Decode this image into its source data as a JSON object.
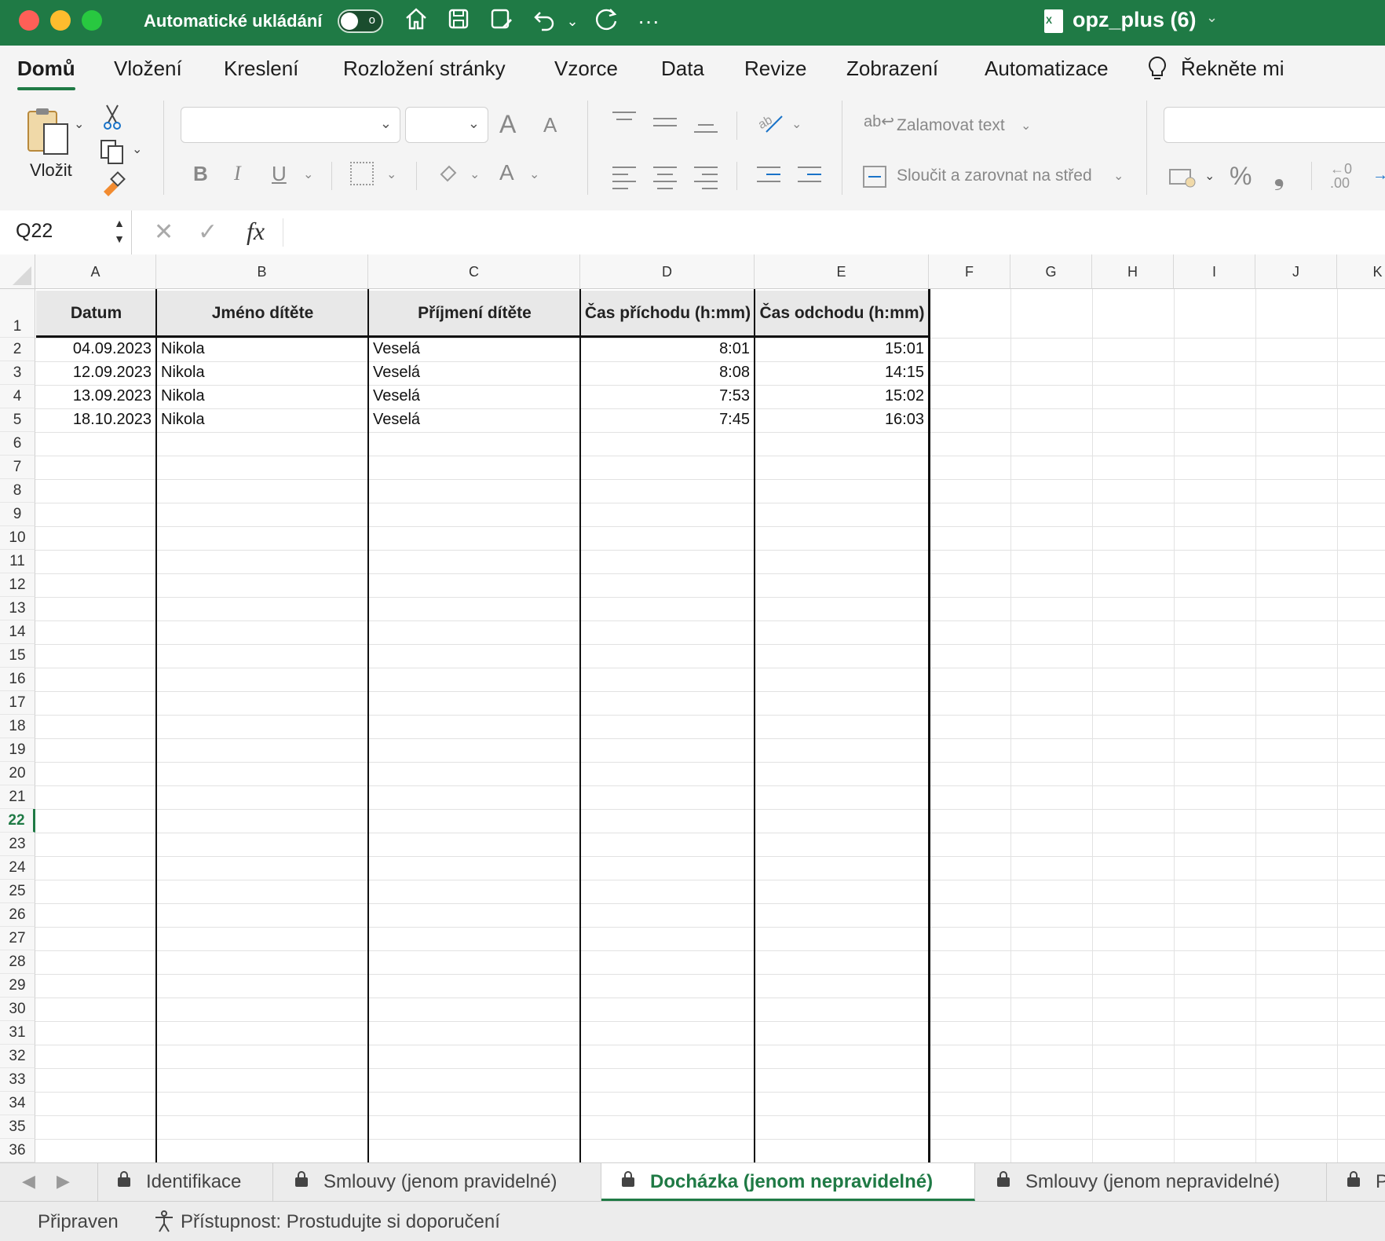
{
  "titlebar": {
    "autosave_label": "Automatické ukládání",
    "autosave_state": "o",
    "doc_title": "opz_plus (6)",
    "doc_icon_text": "X"
  },
  "ribbon_tabs": [
    "Domů",
    "Vložení",
    "Kreslení",
    "Rozložení stránky",
    "Vzorce",
    "Data",
    "Revize",
    "Zobrazení",
    "Automatizace",
    "Řekněte mi"
  ],
  "ribbon": {
    "paste_label": "Vložit",
    "wrap_text": "Zalamovat text",
    "merge_center": "Sloučit a zarovnat na střed",
    "bold": "B",
    "italic": "I",
    "underline": "U",
    "font_grow": "A",
    "font_shrink": "A",
    "font_color": "A",
    "percent": "%",
    "comma": "❟"
  },
  "formula_bar": {
    "name_box": "Q22",
    "fx": "fx",
    "formula": ""
  },
  "columns": [
    "A",
    "B",
    "C",
    "D",
    "E",
    "F",
    "G",
    "H",
    "I",
    "J",
    "K"
  ],
  "table": {
    "headers": [
      "Datum",
      "Jméno dítěte",
      "Příjmení dítěte",
      "Čas příchodu (h:mm)",
      "Čas odchodu (h:mm)"
    ],
    "rows": [
      [
        "04.09.2023",
        "Nikola",
        "Veselá",
        "8:01",
        "15:01"
      ],
      [
        "12.09.2023",
        "Nikola",
        "Veselá",
        "8:08",
        "14:15"
      ],
      [
        "13.09.2023",
        "Nikola",
        "Veselá",
        "7:53",
        "15:02"
      ],
      [
        "18.10.2023",
        "Nikola",
        "Veselá",
        "7:45",
        "16:03"
      ]
    ]
  },
  "row_numbers": [
    "1",
    "2",
    "3",
    "4",
    "5",
    "6",
    "7",
    "8",
    "9",
    "10",
    "11",
    "12",
    "13",
    "14",
    "15",
    "16",
    "17",
    "18",
    "19",
    "20",
    "21",
    "22",
    "23",
    "24",
    "25",
    "26",
    "27",
    "28",
    "29",
    "30",
    "31",
    "32",
    "33",
    "34",
    "35",
    "36"
  ],
  "selected_row": "22",
  "sheet_tabs": [
    {
      "label": "Identifikace",
      "active": false
    },
    {
      "label": "Smlouvy (jenom pravidelné)",
      "active": false
    },
    {
      "label": "Docházka (jenom nepravidelné)",
      "active": true
    },
    {
      "label": "Smlouvy (jenom nepravidelné)",
      "active": false
    },
    {
      "label": "P",
      "active": false
    }
  ],
  "status": {
    "ready": "Připraven",
    "accessibility": "Přístupnost: Prostudujte si doporučení"
  },
  "colors": {
    "accent": "#1f7a45",
    "header_fill": "#e8e8e8"
  }
}
